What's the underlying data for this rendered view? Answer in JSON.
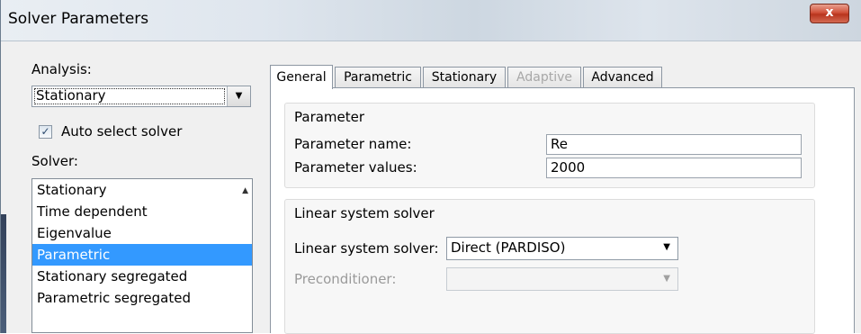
{
  "window": {
    "title": "Solver Parameters",
    "close_label": "x"
  },
  "left": {
    "analysis_label": "Analysis:",
    "analysis_value": "Stationary",
    "auto_select_label": "Auto select solver",
    "auto_select_checked": true,
    "solver_label": "Solver:",
    "solvers": [
      "Stationary",
      "Time dependent",
      "Eigenvalue",
      "Parametric",
      "Stationary segregated",
      "Parametric segregated"
    ],
    "selected_solver": "Parametric"
  },
  "tabs": [
    {
      "label": "General",
      "active": true
    },
    {
      "label": "Parametric",
      "active": false
    },
    {
      "label": "Stationary",
      "active": false
    },
    {
      "label": "Adaptive",
      "active": false,
      "disabled": true
    },
    {
      "label": "Advanced",
      "active": false
    }
  ],
  "parameter": {
    "group_title": "Parameter",
    "name_label": "Parameter name:",
    "name_value": "Re",
    "values_label": "Parameter values:",
    "values_value": "2000"
  },
  "linear": {
    "group_title": "Linear system solver",
    "solver_label": "Linear system solver:",
    "solver_value": "Direct (PARDISO)",
    "preconditioner_label": "Preconditioner:",
    "preconditioner_value": ""
  },
  "colors": {
    "selection": "#3399ff",
    "close_button": "#c7442f",
    "disabled_text": "#a8a8a8"
  },
  "icons": {
    "close": "close-icon",
    "dropdown": "chevron-down-icon",
    "checkbox": "checkmark-icon",
    "scroll": "scroll-up-arrow-icon"
  }
}
